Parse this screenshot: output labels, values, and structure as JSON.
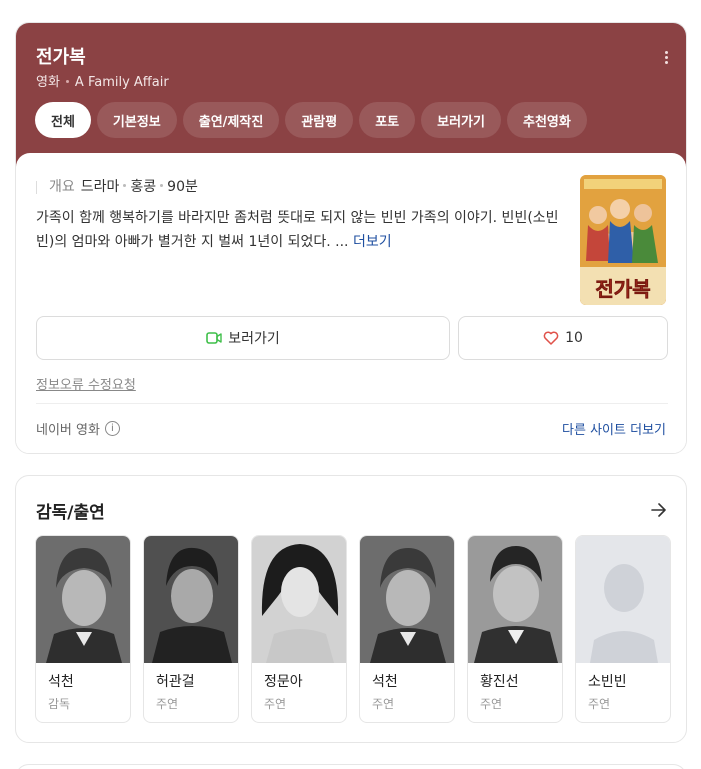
{
  "header": {
    "title": "전가복",
    "category": "영화",
    "english_title": "A Family Affair"
  },
  "tabs": [
    {
      "label": "전체",
      "active": true
    },
    {
      "label": "기본정보"
    },
    {
      "label": "출연/제작진"
    },
    {
      "label": "관람평"
    },
    {
      "label": "포토"
    },
    {
      "label": "보러가기"
    },
    {
      "label": "추천영화"
    }
  ],
  "overview": {
    "label": "개요",
    "genre": "드라마",
    "country": "홍콩",
    "runtime": "90분",
    "description": "가족이 함께 행복하기를 바라지만 좀처럼 뜻대로 되지 않는 빈빈 가족의 이야기. 빈빈(소빈빈)의 엄마와 아빠가 별거한 지 벌써 1년이 되었다. ...",
    "more_label": "더보기",
    "poster_text": "전가복"
  },
  "actions": {
    "watch_label": "보러가기",
    "like_count": "10"
  },
  "links": {
    "report": "정보오류 수정요청",
    "source": "네이버 영화",
    "other_sites": "다른 사이트 더보기"
  },
  "cast": {
    "title": "감독/출연",
    "people": [
      {
        "name": "석천",
        "role": "감독"
      },
      {
        "name": "허관걸",
        "role": "주연"
      },
      {
        "name": "정문아",
        "role": "주연"
      },
      {
        "name": "석천",
        "role": "주연"
      },
      {
        "name": "황진선",
        "role": "주연"
      },
      {
        "name": "소빈빈",
        "role": "주연"
      }
    ]
  },
  "colors": {
    "hero_bg": "#8b4244",
    "link": "#1f4fa0",
    "watch_icon": "#3fbf4a",
    "heart": "#e0524a"
  }
}
